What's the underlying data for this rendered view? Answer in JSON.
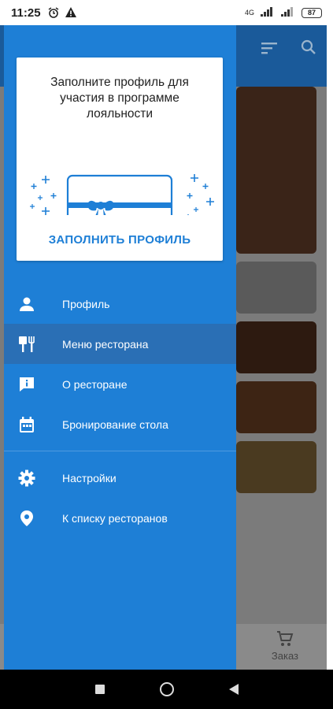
{
  "status_bar": {
    "time": "11:25",
    "network": "4G",
    "battery": "87"
  },
  "background": {
    "order_label": "Заказ"
  },
  "promo": {
    "text": "Заполните профиль для участия в программе лояльности",
    "button_label": "ЗАПОЛНИТЬ ПРОФИЛЬ"
  },
  "menu": {
    "items": [
      {
        "label": "Профиль",
        "icon": "person-icon"
      },
      {
        "label": "Меню ресторана",
        "icon": "restaurant-menu-icon"
      },
      {
        "label": "О ресторане",
        "icon": "info-chat-icon"
      },
      {
        "label": "Бронирование стола",
        "icon": "calendar-icon"
      },
      {
        "label": "Настройки",
        "icon": "gear-icon"
      },
      {
        "label": "К списку ресторанов",
        "icon": "location-pin-icon"
      }
    ],
    "active_index": 1
  },
  "colors": {
    "drawer": "#1e7fd6",
    "active_item": "#2a6fb5",
    "accent": "#1e7fd6"
  }
}
